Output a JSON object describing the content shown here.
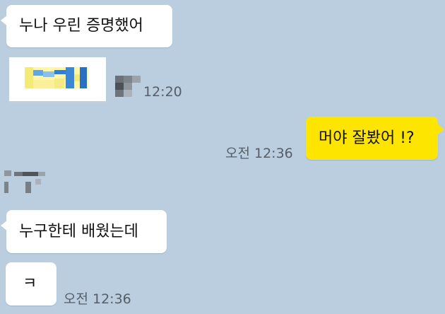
{
  "messages": [
    {
      "text": "누나 우린 증명했어",
      "side": "in"
    },
    {
      "text": "",
      "side": "in",
      "kind": "image-attachment",
      "time": "12:20"
    },
    {
      "text": "머야 잘봤어 !?",
      "side": "out",
      "time": "오전 12:36"
    },
    {
      "text": "누구한테 배웠는데",
      "side": "in"
    },
    {
      "text": "ㅋ",
      "side": "in",
      "time": "오전 12:36"
    }
  ],
  "colors": {
    "background": "#bacee0",
    "incoming_bubble": "#ffffff",
    "outgoing_bubble": "#fee500",
    "timestamp": "#555d66"
  }
}
